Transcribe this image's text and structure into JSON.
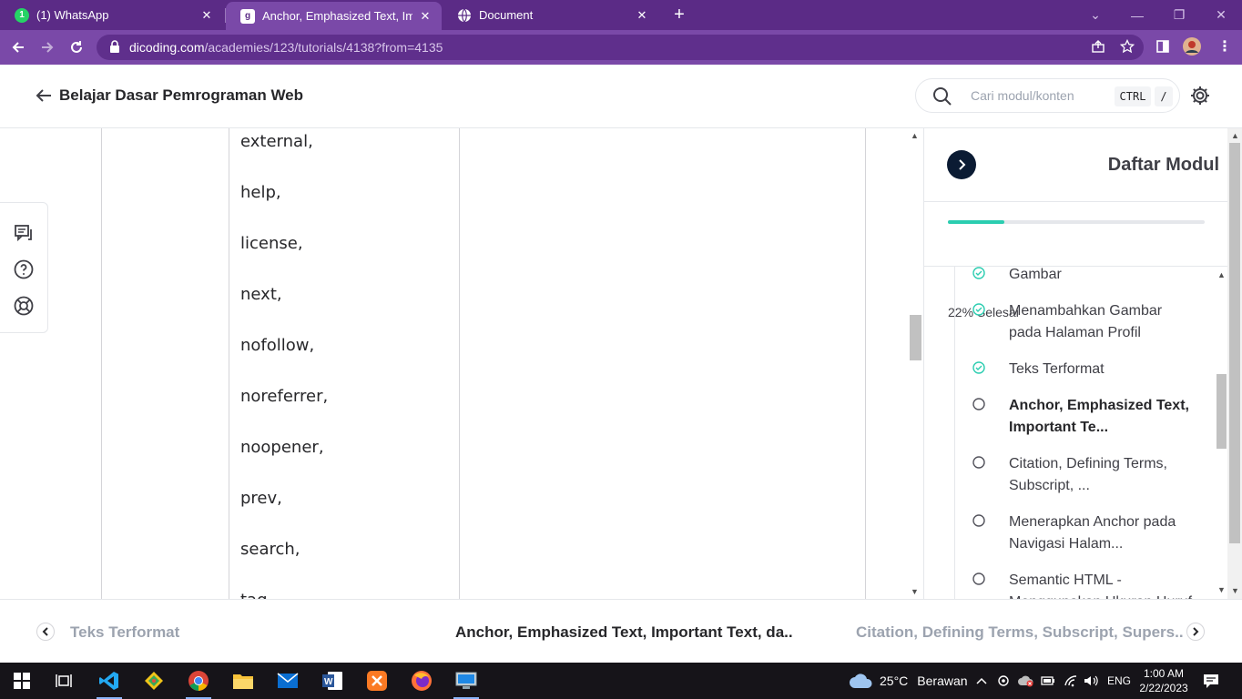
{
  "browser": {
    "tabs": [
      {
        "title": "(1) WhatsApp",
        "active": false
      },
      {
        "title": "Anchor, Emphasized Text, Import",
        "active": true
      },
      {
        "title": "Document",
        "active": false
      }
    ],
    "url_host": "dicoding.com",
    "url_path": "/academies/123/tutorials/4138?from=4135"
  },
  "header": {
    "course_title": "Belajar Dasar Pemrograman Web",
    "search_placeholder": "Cari modul/konten",
    "shortcut_ctrl": "CTRL",
    "shortcut_slash": "/"
  },
  "content": {
    "rel_values": [
      "external,",
      "help,",
      "license,",
      "next,",
      "nofollow,",
      "noreferrer,",
      "noopener,",
      "prev,",
      "search,",
      "tag"
    ]
  },
  "panel": {
    "title": "Daftar Modul",
    "progress_percent": 22,
    "progress_text": "22% Selesai",
    "modules": [
      {
        "label": "Gambar",
        "status": "done"
      },
      {
        "label": "Menambahkan Gambar pada Halaman Profil",
        "status": "done"
      },
      {
        "label": "Teks Terformat",
        "status": "done"
      },
      {
        "label": "Anchor, Emphasized Text, Important Te...",
        "status": "current"
      },
      {
        "label": "Citation, Defining Terms, Subscript, ...",
        "status": "todo"
      },
      {
        "label": "Menerapkan Anchor pada Navigasi Halam...",
        "status": "todo"
      },
      {
        "label": "Semantic HTML - Menggunakan Ukuran Huruf",
        "status": "todo"
      }
    ]
  },
  "bottom_nav": {
    "prev_label": "Teks Terformat",
    "current_label": "Anchor, Emphasized Text, Important Text, da..",
    "next_label": "Citation, Defining Terms, Subscript, Supers.."
  },
  "taskbar": {
    "weather_temp": "25°C",
    "weather_text": "Berawan",
    "language": "ENG",
    "time": "1:00 AM",
    "date": "2/22/2023"
  },
  "colors": {
    "chrome_dark": "#5b2b86",
    "chrome_light": "#7a49a8",
    "progress": "#2bcdb0",
    "done_check": "#2bcdb0",
    "toggle_bg": "#0b1b33"
  }
}
